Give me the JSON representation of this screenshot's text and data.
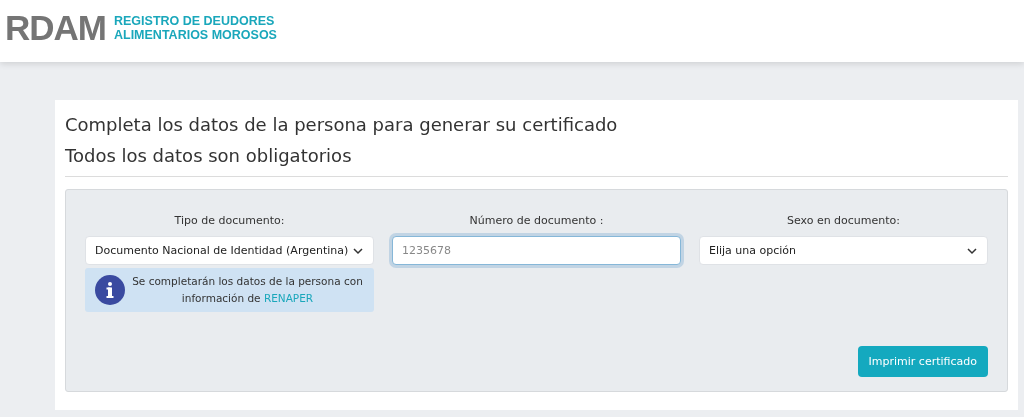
{
  "logo": {
    "acronym": "RDAM",
    "line_1": "REGISTRO DE DEUDORES",
    "line_2": "ALIMENTARIOS MOROSOS"
  },
  "heading": {
    "line_1": "Completa los datos de la persona para generar su certificado",
    "line_2": "Todos los datos son obligatorios"
  },
  "fields": [
    {
      "kind": "select",
      "label": "Tipo de documento:",
      "value": "Documento Nacional de Identidad (Argentina)",
      "focused": false,
      "info": {
        "text": "Se completarán los datos de la persona con información de ",
        "link": "RENAPER"
      }
    },
    {
      "kind": "input",
      "label": "Número de documento :",
      "placeholder": "1235678",
      "focused": true
    },
    {
      "kind": "select",
      "label": "Sexo en documento:",
      "value": "Elija una opción",
      "focused": false
    }
  ],
  "submit": "Imprimir certificado"
}
